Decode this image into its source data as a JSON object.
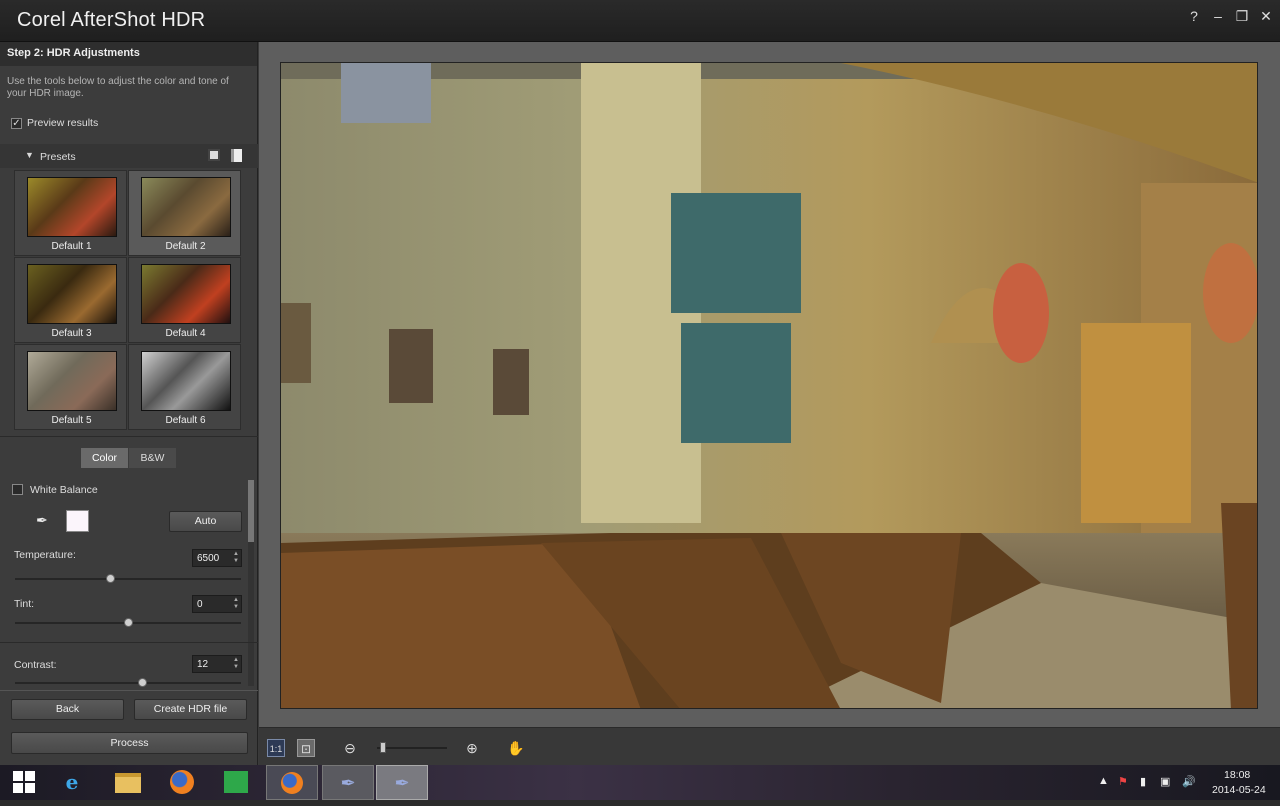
{
  "window": {
    "title": "Corel AfterShot HDR",
    "help": "?",
    "minimize": "–",
    "maximize": "❐",
    "close": "✕"
  },
  "sidebar": {
    "step_title": "Step 2: HDR Adjustments",
    "description": "Use the tools below to adjust the color and tone of your HDR image.",
    "preview_label": "Preview results",
    "preview_checked": true,
    "presets_label": "Presets",
    "presets": [
      {
        "name": "Default 1",
        "selected": false
      },
      {
        "name": "Default 2",
        "selected": true
      },
      {
        "name": "Default 3",
        "selected": false
      },
      {
        "name": "Default 4",
        "selected": false
      },
      {
        "name": "Default 5",
        "selected": false
      },
      {
        "name": "Default 6",
        "selected": false
      }
    ],
    "tabs": {
      "color": "Color",
      "bw": "B&W",
      "active": "Color"
    },
    "white_balance_label": "White Balance",
    "white_balance_checked": false,
    "auto_button": "Auto",
    "temperature": {
      "label": "Temperature:",
      "value": "6500",
      "level": 0.42
    },
    "tint": {
      "label": "Tint:",
      "value": "0",
      "level": 0.5
    },
    "contrast": {
      "label": "Contrast:",
      "value": "12",
      "level": 0.56
    },
    "back_button": "Back",
    "create_button": "Create HDR file",
    "process_button": "Process"
  },
  "viewer": {
    "zoom_level": 0.1,
    "tools": [
      "actual-size-icon",
      "fit-to-window-icon",
      "zoom-out-icon",
      "zoom-in-icon",
      "pan-hand-icon"
    ]
  },
  "taskbar": {
    "time": "18:08",
    "date": "2014-05-24"
  }
}
